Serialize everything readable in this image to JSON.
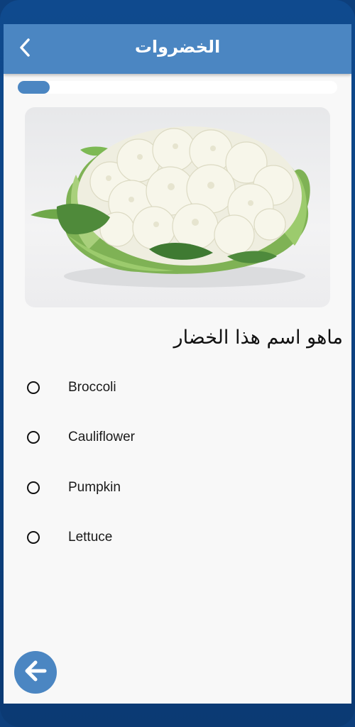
{
  "appbar": {
    "title": "الخضروات",
    "back_icon": "chevron-left-icon"
  },
  "progress": {
    "fraction": 0.1
  },
  "image": {
    "subject": "cauliflower"
  },
  "question": {
    "text": "ماهو اسم هذا الخضار"
  },
  "options": [
    {
      "label": "Broccoli"
    },
    {
      "label": "Cauliflower"
    },
    {
      "label": "Pumpkin"
    },
    {
      "label": "Lettuce"
    }
  ],
  "fab": {
    "icon": "arrow-left-icon"
  },
  "colors": {
    "primary": "#4b86c2",
    "device_frame": "#0f4a8e",
    "background": "#f8f8f8"
  }
}
